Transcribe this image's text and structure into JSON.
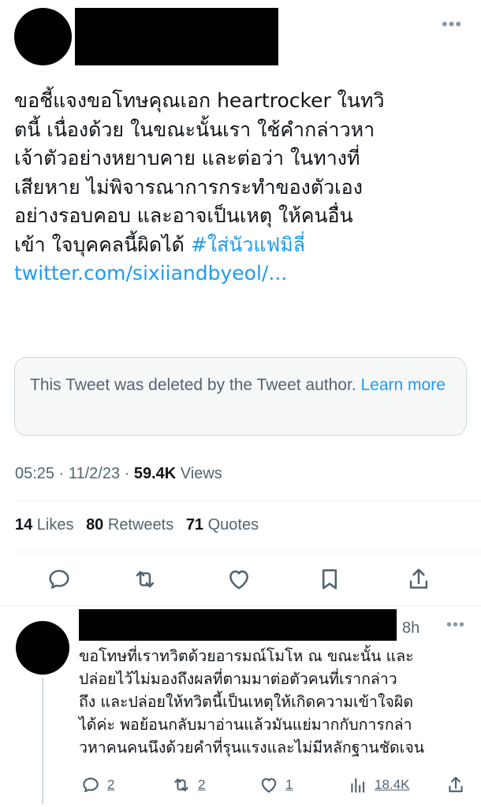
{
  "main_tweet": {
    "more_glyph": "•••",
    "text_lines": [
      "ขอชี้แจงขอโทษคุณเอก heartrocker  ในทวิ",
      "ตนี้ เนื่องด้วย ในขณะนั้นเรา ใช้คำกล่าวหา",
      "เจ้าตัวอย่างหยาบคาย  และต่อว่า ในทางที่",
      "เสียหาย ไม่พิจารณาการกระทำของตัวเอง",
      "อย่างรอบคอบ และอาจเป็นเหตุ ให้คนอื่น"
    ],
    "line6_text": "เข้า ใจบุคคลนี้ผิดได้ ",
    "hashtag": "#ใส่นัวแฟมิลี่",
    "link": "twitter.com/sixiiandbyeol/...",
    "deleted_notice": "This Tweet was deleted by the Tweet author. ",
    "learn_more": "Learn more",
    "time": "05:25 · 11/2/23 · ",
    "views_count": "59.4K",
    "views_label": " Views",
    "likes_count": "14",
    "likes_label": " Likes",
    "retweets_count": "80",
    "retweets_label": " Retweets",
    "quotes_count": "71",
    "quotes_label": " Quotes"
  },
  "actions": {
    "reply_icon": "reply-icon",
    "retweet_icon": "retweet-icon",
    "like_icon": "heart-icon",
    "bookmark_icon": "bookmark-icon",
    "share_icon": "share-icon"
  },
  "reply_tweet": {
    "time": "8h",
    "more_glyph": "•••",
    "text_lines": [
      "ขอโทษที่เราทวิตด้วยอารมณ์โมโห ณ ขณะนั้น และ",
      "ปล่อยไว้ไม่มองถึงผลที่ตามมาต่อตัวคนที่เรากล่าว",
      "ถึง และปล่อยให้ทวิตนี้เป็นเหตุให้เกิดความเข้าใจผิด",
      "ได้ค่ะ พอย้อนกลับมาอ่านแล้วมันแย่มากกับการกล่า",
      "วหาคนคนนึงด้วยคำที่รุนแรงและไม่มีหลักฐานชัดเจน"
    ],
    "reply_count": "2",
    "retweet_count": "2",
    "like_count": "1",
    "views_count": "18.4K"
  }
}
